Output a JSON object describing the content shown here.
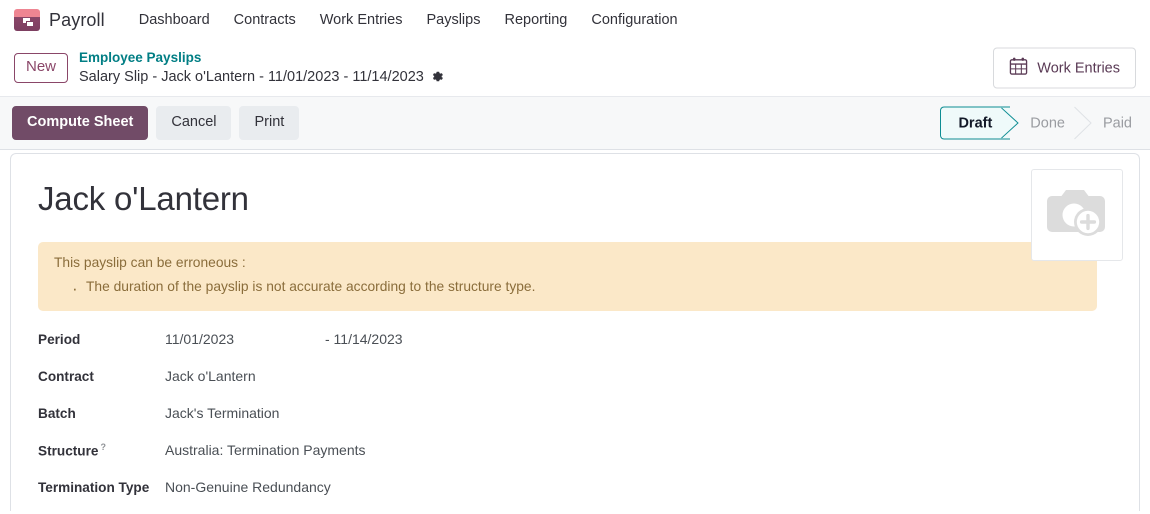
{
  "navbar": {
    "brand": "Payroll",
    "brand_logo_icon": "payroll-app-logo",
    "menu": [
      {
        "label": "Dashboard"
      },
      {
        "label": "Contracts"
      },
      {
        "label": "Work Entries"
      },
      {
        "label": "Payslips"
      },
      {
        "label": "Reporting"
      },
      {
        "label": "Configuration"
      }
    ]
  },
  "breadcrumb": {
    "new_label": "New",
    "parent": "Employee Payslips",
    "current": "Salary Slip - Jack o'Lantern - 11/01/2023 - 11/14/2023",
    "settings_icon": "gear-icon",
    "work_entries_button": {
      "label": "Work Entries",
      "icon": "calendar-icon"
    }
  },
  "statusbar": {
    "buttons": [
      {
        "label": "Compute Sheet",
        "style": "primary"
      },
      {
        "label": "Cancel",
        "style": "secondary"
      },
      {
        "label": "Print",
        "style": "secondary"
      }
    ],
    "stages": [
      {
        "label": "Draft",
        "active": true
      },
      {
        "label": "Done",
        "active": false
      },
      {
        "label": "Paid",
        "active": false
      }
    ]
  },
  "sheet": {
    "title": "Jack o'Lantern",
    "avatar_placeholder_icon": "camera-add-icon",
    "alert": {
      "heading": "This payslip can be erroneous :",
      "items": [
        "The duration of the payslip is not accurate according to the structure type."
      ]
    },
    "fields": {
      "period": {
        "label": "Period",
        "date_from": "11/01/2023",
        "date_to": "- 11/14/2023"
      },
      "contract": {
        "label": "Contract",
        "value": "Jack o'Lantern"
      },
      "batch": {
        "label": "Batch",
        "value": "Jack's Termination"
      },
      "structure": {
        "label": "Structure",
        "tip": "?",
        "value": "Australia: Termination Payments"
      },
      "termination_type": {
        "label": "Termination Type",
        "value": "Non-Genuine Redundancy"
      }
    }
  },
  "colors": {
    "brand_purple": "#714b67",
    "link_teal": "#017e84",
    "alert_bg": "#fbe8c8",
    "alert_text": "#8a6d3b",
    "stage_active_border": "#0d8d93"
  }
}
